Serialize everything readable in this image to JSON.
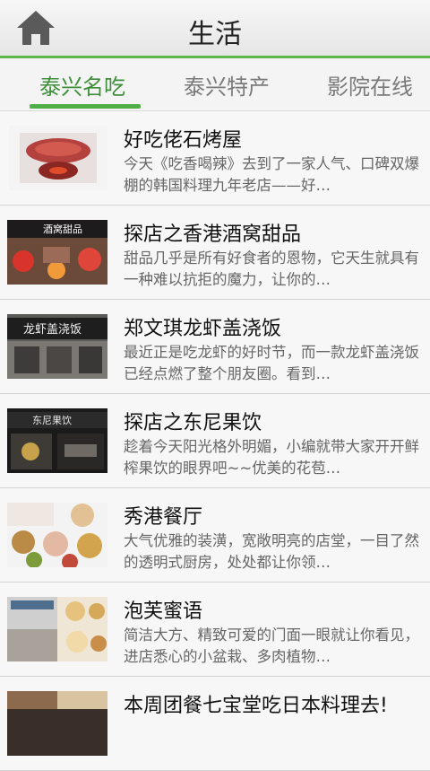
{
  "header": {
    "title": "生活",
    "home_icon": "home-icon"
  },
  "tabs": [
    {
      "label": "泰兴名吃",
      "active": true
    },
    {
      "label": "泰兴特产",
      "active": false
    },
    {
      "label": "影院在线",
      "active": false
    }
  ],
  "items": [
    {
      "title": "好吃佬石烤屋",
      "desc": "今天《吃香喝辣》去到了一家人气、口碑双爆棚的韩国料理九年老店——好…"
    },
    {
      "title": "探店之香港酒窝甜品",
      "desc": "甜品几乎是所有好食者的恩物，它天生就具有一种难以抗拒的魔力，让你的…"
    },
    {
      "title": "郑文琪龙虾盖浇饭",
      "desc": "最近正是吃龙虾的好时节，而一款龙虾盖浇饭已经点燃了整个朋友圈。看到…"
    },
    {
      "title": "探店之东尼果饮",
      "desc": "趁着今天阳光格外明媚，小编就带大家开开鲜榨果饮的眼界吧~~优美的花苞…"
    },
    {
      "title": "秀港餐厅",
      "desc": "大气优雅的装潢，宽敞明亮的店堂，一目了然的透明式厨房，处处都让你领…"
    },
    {
      "title": "泡芙蜜语",
      "desc": "简洁大方、精致可爱的门面一眼就让你看见，进店悉心的小盆栽、多肉植物…"
    },
    {
      "title": "本周团餐七宝堂吃日本料理去!",
      "desc": ""
    }
  ],
  "thumb_texts": {
    "item1": "酒窝甜品",
    "item2": "龙虾盖浇饭",
    "item3": "东尼果饮"
  },
  "colors": {
    "accent": "#4fae45",
    "active_tab": "#3f8f3a"
  }
}
